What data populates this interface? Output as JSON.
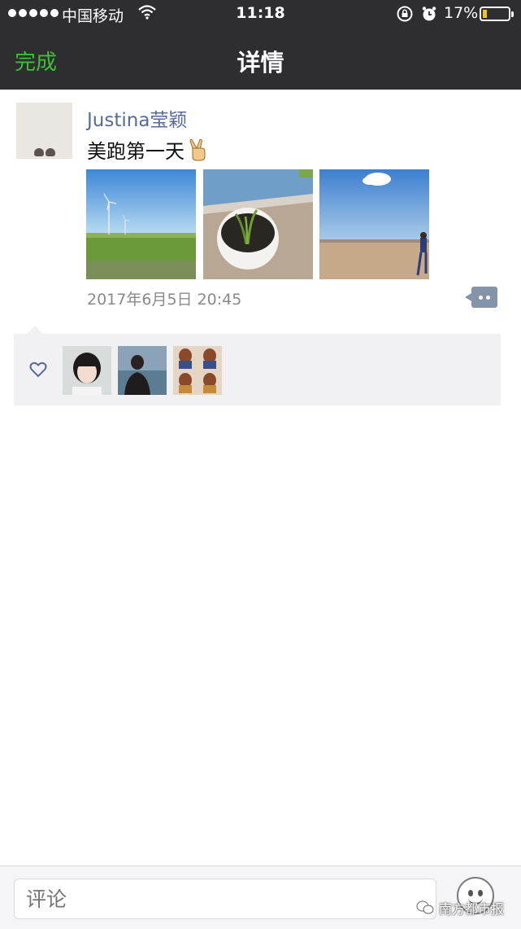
{
  "status_bar": {
    "carrier": "中国移动",
    "time": "11:18",
    "battery_percent": "17%",
    "battery_level": 0.17,
    "icons": [
      "signal-dots",
      "wifi-icon",
      "rotation-lock-icon",
      "alarm-icon",
      "battery-icon"
    ]
  },
  "nav": {
    "done_label": "完成",
    "title": "详情",
    "accent_color": "#3fbf38",
    "background_color": "#2e2e30"
  },
  "post": {
    "username": "Justina莹颖",
    "text": "美跑第一天",
    "emoji": "victory-hand",
    "photos": [
      {
        "name": "wind-turbines-field"
      },
      {
        "name": "potted-seedling"
      },
      {
        "name": "sky-open-field-person"
      }
    ],
    "timestamp": "2017年6月5日 20:45",
    "username_color": "#576b95"
  },
  "likes": {
    "icon": "heart-outline-icon",
    "likers": [
      {
        "name": "liker-avatar-1"
      },
      {
        "name": "liker-avatar-2"
      },
      {
        "name": "liker-avatar-3"
      }
    ]
  },
  "comment_bar": {
    "placeholder": "评论",
    "emoji_icon": "smiley-icon"
  },
  "watermark": {
    "text": "南方都市报"
  }
}
